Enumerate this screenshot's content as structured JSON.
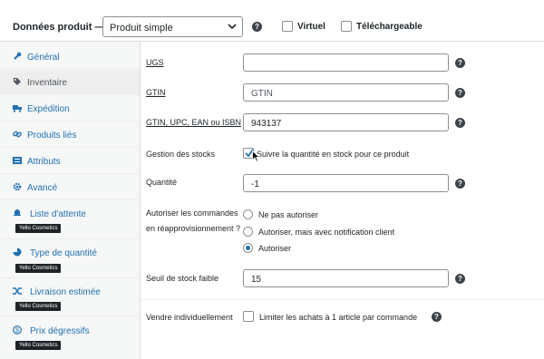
{
  "header": {
    "title": "Données produit —",
    "product_type": "Produit simple",
    "virtual_label": "Virtuel",
    "downloadable_label": "Téléchargeable"
  },
  "sidebar": {
    "items": [
      {
        "label": "Général",
        "icon": "wrench-icon"
      },
      {
        "label": "Inventaire",
        "icon": "tag-icon"
      },
      {
        "label": "Expédition",
        "icon": "truck-icon"
      },
      {
        "label": "Produits liés",
        "icon": "link-icon"
      },
      {
        "label": "Attributs",
        "icon": "list-icon"
      },
      {
        "label": "Avancé",
        "icon": "gear-icon"
      },
      {
        "label": "Liste d'attente",
        "icon": "bell-icon",
        "badge": "Yello Cosmetics"
      },
      {
        "label": "Type de quantité",
        "icon": "pie-icon",
        "badge": "Yello Cosmetics"
      },
      {
        "label": "Livraison estimée",
        "icon": "shuffle-icon",
        "badge": "Yello Cosmetics"
      },
      {
        "label": "Prix dégressifs",
        "icon": "dollar-icon",
        "badge": "Yello Cosmetics"
      }
    ]
  },
  "fields": {
    "ugs_label": "UGS",
    "ugs_value": "",
    "gtin_label": "GTIN",
    "gtin_placeholder": "GTIN",
    "gtin2_label": "GTIN, UPC, EAN ou ISBN",
    "gtin2_value": "943137",
    "stock_label": "Gestion des stocks",
    "stock_checkbox": "Suivre la quantité en stock pour ce produit",
    "qty_label": "Quantité",
    "qty_value": "-1",
    "backorder_label_1": "Autoriser les commandes",
    "backorder_label_2": "en réapprovisionnement ?",
    "backorder_options": [
      "Ne pas autoriser",
      "Autoriser, mais avec notification client",
      "Autoriser"
    ],
    "backorder_selected": "Autoriser",
    "low_stock_label": "Seuil de stock faible",
    "low_stock_value": "15",
    "sold_ind_label": "Vendre individuellement",
    "sold_ind_checkbox": "Limiter les achats à 1 article par commande"
  },
  "colors": {
    "accent": "#2271b1",
    "sidebar_bg": "#f6f7f7",
    "badge_bg": "#1d2327"
  }
}
